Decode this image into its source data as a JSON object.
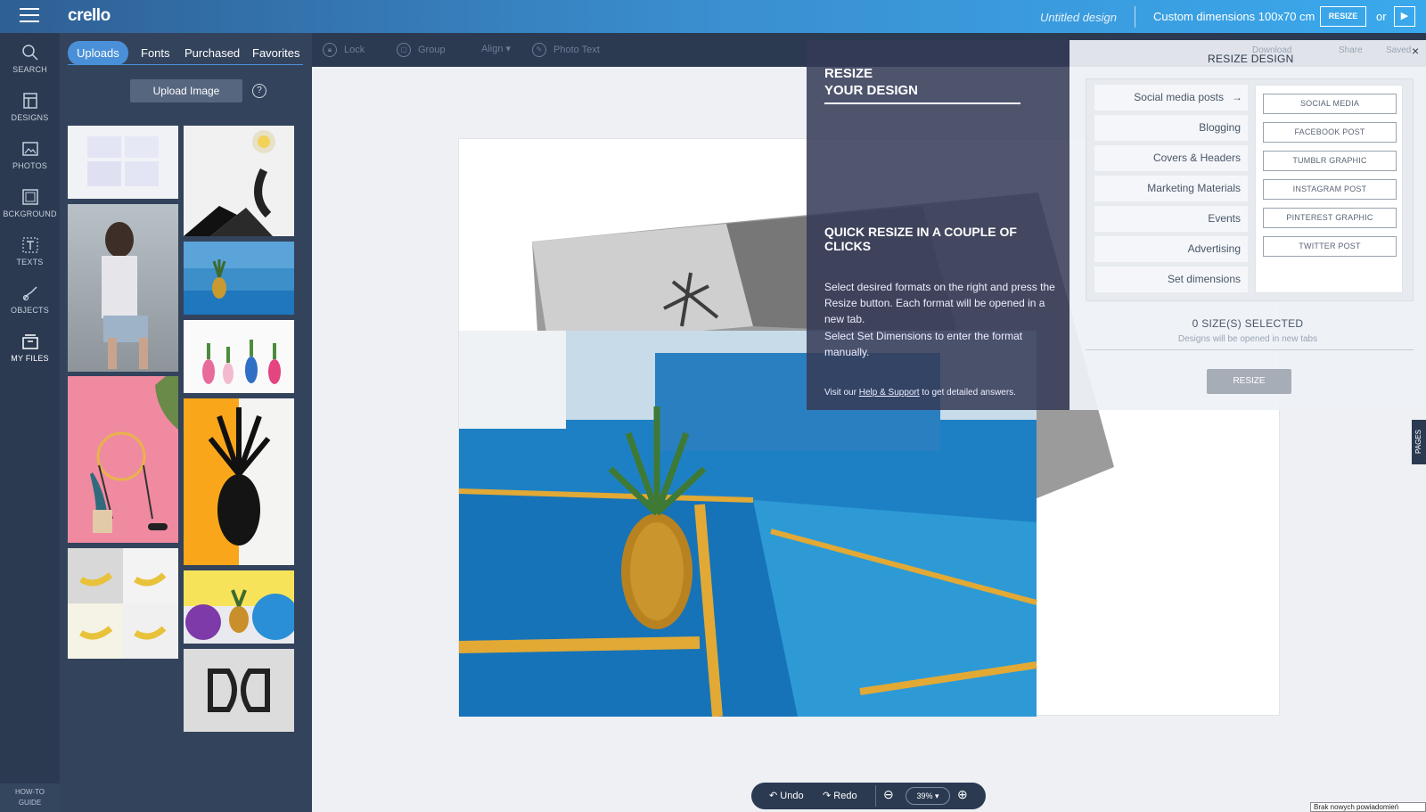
{
  "topbar": {
    "logo": "crello",
    "doc_title": "Untitled design",
    "dims": "Custom dimensions 100x70 cm",
    "resize_label": "RESIZE",
    "or_label": "or",
    "play_icon": "play-icon"
  },
  "leftnav": {
    "items": [
      {
        "label": "SEARCH",
        "icon": "search-icon"
      },
      {
        "label": "DESIGNS",
        "icon": "designs-icon"
      },
      {
        "label": "PHOTOS",
        "icon": "photos-icon"
      },
      {
        "label": "BCKGROUND",
        "icon": "background-icon"
      },
      {
        "label": "TEXTS",
        "icon": "texts-icon"
      },
      {
        "label": "OBJECTS",
        "icon": "objects-icon"
      },
      {
        "label": "MY FILES",
        "icon": "my-files-icon"
      }
    ],
    "howto": [
      "HOW-TO",
      "GUIDE"
    ]
  },
  "panel": {
    "tabs": [
      "Uploads",
      "Fonts",
      "Purchased",
      "Favorites"
    ],
    "upload_label": "Upload Image",
    "help": "?"
  },
  "toolbar2": {
    "lock": "Lock",
    "group": "Group",
    "align": "Align",
    "photo_text": "Photo Text"
  },
  "resize_panel": {
    "left_title_1": "RESIZE",
    "left_title_2": "YOUR DESIGN",
    "left_heading": "QUICK RESIZE IN A COUPLE OF CLICKS",
    "left_p1": "Select desired formats on the right and press the Resize button. Each format will be opened in a new tab.",
    "left_p2": "Select Set Dimensions to enter the format manually.",
    "visit_prefix": "Visit our ",
    "visit_link": "Help & Support",
    "visit_suffix": " to get detailed answers.",
    "title": "RESIZE DESIGN",
    "close": "×",
    "toplinks": [
      "Download",
      "Share",
      "Saved"
    ],
    "categories": [
      "Social media posts",
      "Blogging",
      "Covers & Headers",
      "Marketing Materials",
      "Events",
      "Advertising",
      "Set dimensions"
    ],
    "formats": [
      "SOCIAL MEDIA",
      "FACEBOOK POST",
      "TUMBLR GRAPHIC",
      "INSTAGRAM POST",
      "PINTEREST GRAPHIC",
      "TWITTER POST"
    ],
    "sizes_selected": "0 SIZE(S) SELECTED",
    "sizes_note": "Designs will be opened in new tabs",
    "resize_btn": "RESIZE"
  },
  "pages_tab": "PAGES",
  "bottombar": {
    "undo": "Undo",
    "redo": "Redo",
    "zoom": "39%"
  },
  "notification": "Brak nowych powiadomień"
}
